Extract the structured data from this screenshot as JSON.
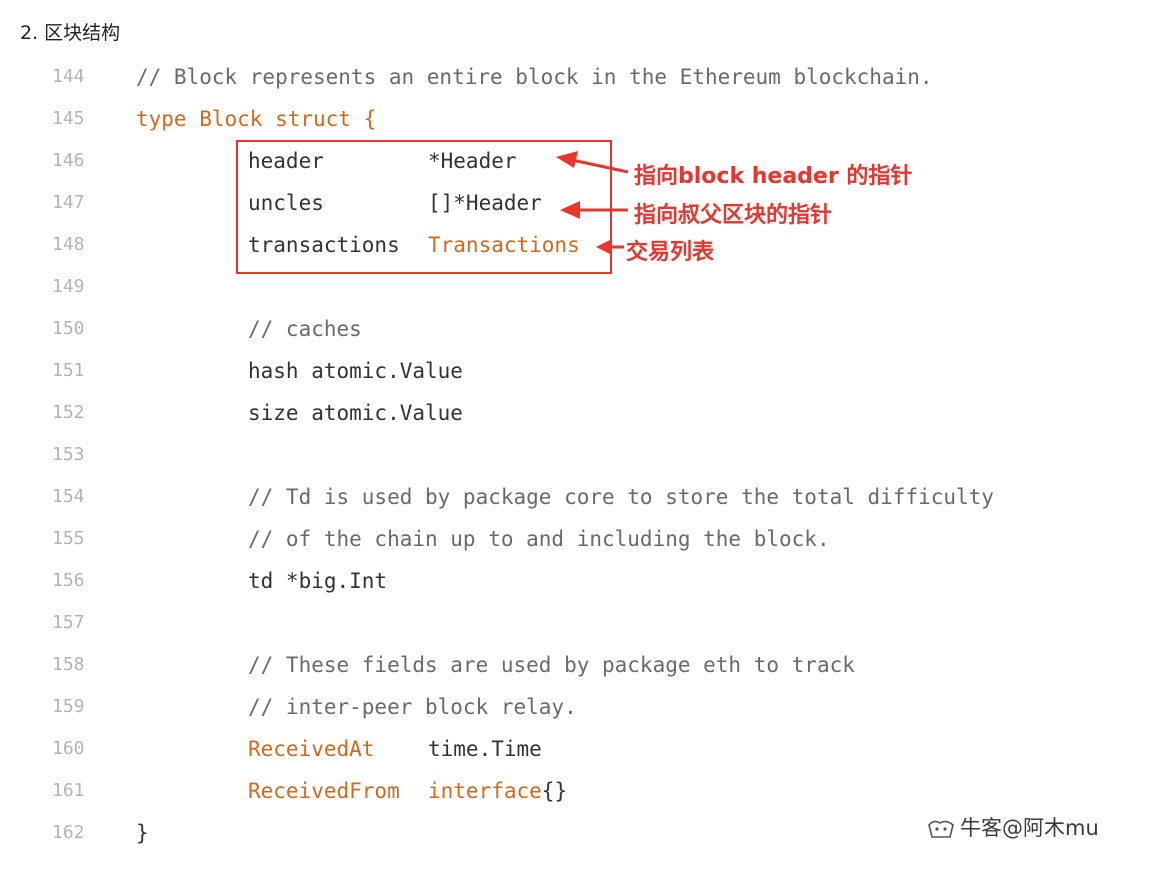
{
  "heading": "2. 区块结构",
  "lines": [
    {
      "n": "144",
      "indent": 0,
      "parts": [
        {
          "t": "// Block represents an entire block in the Ethereum blockchain.",
          "c": "comment"
        }
      ]
    },
    {
      "n": "145",
      "indent": 0,
      "parts": [
        {
          "t": "type Block struct {",
          "c": "kw"
        }
      ]
    },
    {
      "n": "146",
      "indent": 1,
      "parts": [
        {
          "t": "header",
          "c": "plain"
        }
      ],
      "col2": [
        {
          "t": "*Header",
          "c": "plain"
        }
      ]
    },
    {
      "n": "147",
      "indent": 1,
      "parts": [
        {
          "t": "uncles",
          "c": "plain"
        }
      ],
      "col2": [
        {
          "t": "[]*Header",
          "c": "plain"
        }
      ]
    },
    {
      "n": "148",
      "indent": 1,
      "parts": [
        {
          "t": "transactions",
          "c": "plain"
        }
      ],
      "col2": [
        {
          "t": "Transactions",
          "c": "kw"
        }
      ]
    },
    {
      "n": "149",
      "indent": 0,
      "parts": []
    },
    {
      "n": "150",
      "indent": 1,
      "parts": [
        {
          "t": "// caches",
          "c": "comment"
        }
      ]
    },
    {
      "n": "151",
      "indent": 1,
      "parts": [
        {
          "t": "hash atomic.Value",
          "c": "plain"
        }
      ]
    },
    {
      "n": "152",
      "indent": 1,
      "parts": [
        {
          "t": "size atomic.Value",
          "c": "plain"
        }
      ]
    },
    {
      "n": "153",
      "indent": 0,
      "parts": []
    },
    {
      "n": "154",
      "indent": 1,
      "parts": [
        {
          "t": "// Td is used by package core to store the total difficulty",
          "c": "comment"
        }
      ]
    },
    {
      "n": "155",
      "indent": 1,
      "parts": [
        {
          "t": "// of the chain up to and including the block.",
          "c": "comment"
        }
      ]
    },
    {
      "n": "156",
      "indent": 1,
      "parts": [
        {
          "t": "td *big.Int",
          "c": "plain"
        }
      ]
    },
    {
      "n": "157",
      "indent": 0,
      "parts": []
    },
    {
      "n": "158",
      "indent": 1,
      "parts": [
        {
          "t": "// These fields are used by package eth to track",
          "c": "comment"
        }
      ]
    },
    {
      "n": "159",
      "indent": 1,
      "parts": [
        {
          "t": "// inter-peer block relay.",
          "c": "comment"
        }
      ]
    },
    {
      "n": "160",
      "indent": 1,
      "parts": [
        {
          "t": "ReceivedAt",
          "c": "kw"
        }
      ],
      "col2": [
        {
          "t": "time.Time",
          "c": "plain"
        }
      ],
      "col2b": true
    },
    {
      "n": "161",
      "indent": 1,
      "parts": [
        {
          "t": "ReceivedFrom",
          "c": "kw"
        }
      ],
      "col2": [
        {
          "t": "interface",
          "c": "kw"
        },
        {
          "t": "{}",
          "c": "plain"
        }
      ]
    },
    {
      "n": "162",
      "indent": 0,
      "parts": [
        {
          "t": "}",
          "c": "plain"
        }
      ]
    }
  ],
  "annotations": {
    "a1": "指向block header 的指针",
    "a2": "指向叔父区块的指针",
    "a3": "交易列表"
  },
  "watermark": "牛客@阿木mu",
  "colors": {
    "accent_red": "#e8352e",
    "keyword_orange": "#d2691e"
  }
}
